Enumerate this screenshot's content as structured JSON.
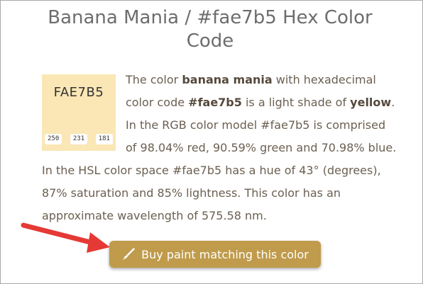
{
  "page": {
    "title": "Banana Mania / #fae7b5 Hex Color Code"
  },
  "swatch": {
    "hex_label": "FAE7B5",
    "color": "#fae7b5",
    "rgb": [
      "250",
      "231",
      "181"
    ]
  },
  "description": {
    "p1": "The color ",
    "name": "banana mania",
    "p2": " with hexadecimal color code ",
    "hex": "#fae7b5",
    "p3": " is a light shade of ",
    "shade": "yellow",
    "p4": ". In the RGB color model #fae7b5 is comprised of 98.04% red, 90.59% green and 70.98% blue. In the HSL color space #fae7b5 has a hue of 43° (degrees), 87% saturation and 85% lightness. This color has an approximate wavelength of 575.58 nm."
  },
  "buy_button": {
    "label": "Buy paint matching this color",
    "icon": "paintbrush-icon",
    "color": "#bf9b4b"
  },
  "annotation": {
    "icon": "red-arrow-icon",
    "color": "#e53935"
  }
}
